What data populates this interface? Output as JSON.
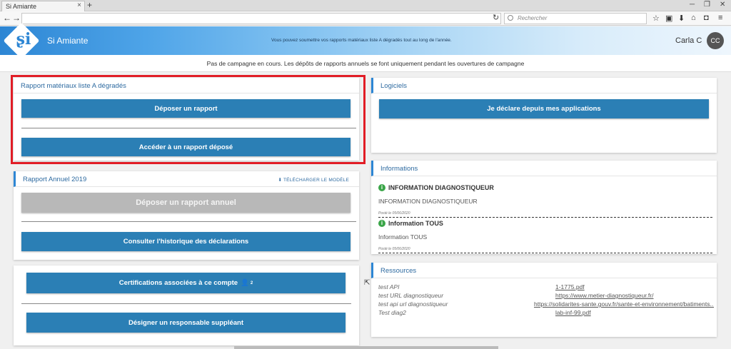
{
  "browser": {
    "tab_title": "Si Amiante",
    "tab_close": "×",
    "new_tab": "+",
    "search_placeholder": "Rechercher",
    "win_min": "─",
    "win_max": "❐",
    "win_close": "✕"
  },
  "header": {
    "app_name": "Si Amiante",
    "banner": "Vous pouvez soumettre vos rapports matériaux liste A dégradés tout au long de l'année.",
    "user_name": "Carla C",
    "user_initials": "CC"
  },
  "campaign_notice": "Pas de campagne en cours. Les dépôts de rapports annuels se font uniquement pendant les ouvertures de campagne",
  "rapport_liste_a": {
    "title": "Rapport matériaux liste A dégradés",
    "deposit_label": "Déposer un rapport",
    "access_label": "Accéder à un rapport déposé"
  },
  "rapport_annuel": {
    "title": "Rapport Annuel 2019",
    "download_label": "TÉLÉCHARGER LE MODÈLE",
    "deposit_label": "Déposer un rapport annuel",
    "history_label": "Consulter l'historique des déclarations"
  },
  "certifications": {
    "certif_label": "Certifications associées à ce compte",
    "certif_count": "2",
    "substitute_label": "Désigner un responsable suppléant"
  },
  "logiciels": {
    "title": "Logiciels",
    "declare_label": "Je déclare depuis mes applications"
  },
  "informations": {
    "title": "Informations",
    "items": [
      {
        "heading": "INFORMATION DIAGNOSTIQUEUR",
        "body": "INFORMATION DIAGNOSTIQUEUR",
        "date": "Posté le 05/06/2020"
      },
      {
        "heading": "Information TOUS",
        "body": "Information TOUS",
        "date": "Posté le 05/06/2020"
      }
    ]
  },
  "ressources": {
    "title": "Ressources",
    "items": [
      {
        "name": "test API",
        "link": "1-1775.pdf"
      },
      {
        "name": "test URL diagnostiqueur",
        "link": "https://www.metier-diagnostiqueur.fr/"
      },
      {
        "name": "test api url diagnostiqueur",
        "link": "https://solidarites-sante.gouv.fr/sante-et-environnement/batiments..."
      },
      {
        "name": "Test diag2",
        "link": "lab-inf-99.pdf"
      }
    ]
  }
}
